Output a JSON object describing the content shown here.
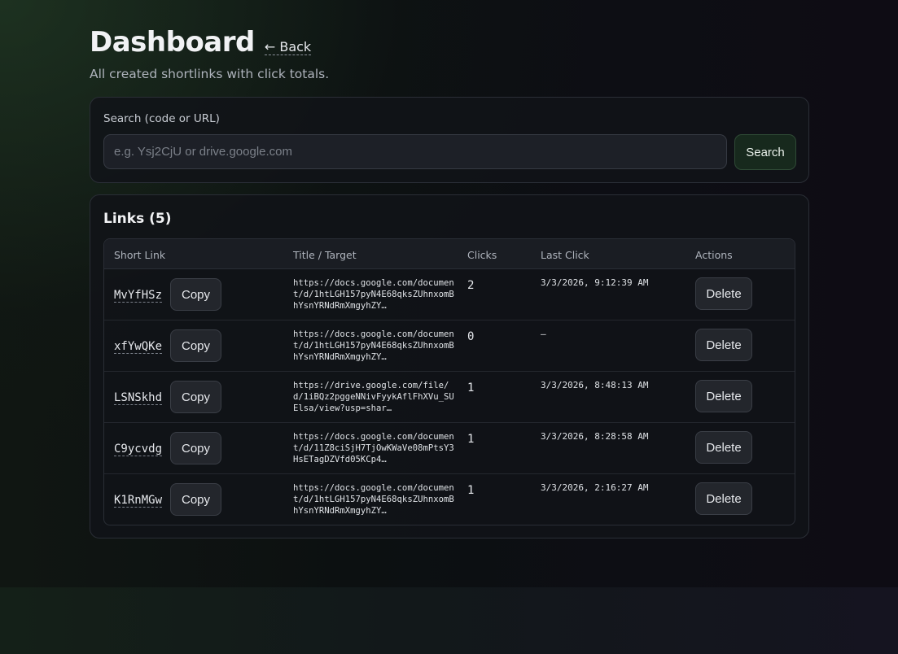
{
  "page": {
    "title": "Dashboard",
    "back_label": "← Back",
    "subtitle": "All created shortlinks with click totals."
  },
  "search": {
    "label": "Search (code or URL)",
    "placeholder": "e.g. Ysj2CjU or drive.google.com",
    "value": "",
    "button_label": "Search"
  },
  "links": {
    "title": "Links (5)",
    "columns": [
      "Short Link",
      "Title / Target",
      "Clicks",
      "Last Click",
      "Actions"
    ],
    "copy_label": "Copy",
    "delete_label": "Delete",
    "rows": [
      {
        "code": "MvYfHSz",
        "target": "https://docs.google.com/document/d/1htLGH157pyN4E68qksZUhnxomBhYsnYRNdRmXmgyhZY…",
        "clicks": "2",
        "last_click": "3/3/2026, 9:12:39 AM"
      },
      {
        "code": "xfYwQKe",
        "target": "https://docs.google.com/document/d/1htLGH157pyN4E68qksZUhnxomBhYsnYRNdRmXmgyhZY…",
        "clicks": "0",
        "last_click": "—"
      },
      {
        "code": "LSNSkhd",
        "target": "https://drive.google.com/file/d/1iBQz2pggeNNivFyykAflFhXVu_SUElsa/view?usp=shar…",
        "clicks": "1",
        "last_click": "3/3/2026, 8:48:13 AM"
      },
      {
        "code": "C9ycvdg",
        "target": "https://docs.google.com/document/d/11Z8ciSjH7TjOwKWaVe08mPtsY3HsETagDZVfd05KCp4…",
        "clicks": "1",
        "last_click": "3/3/2026, 8:28:58 AM"
      },
      {
        "code": "K1RnMGw",
        "target": "https://docs.google.com/document/d/1htLGH157pyN4E68qksZUhnxomBhYsnYRNdRmXmgyhZY…",
        "clicks": "1",
        "last_click": "3/3/2026, 2:16:27 AM"
      }
    ]
  },
  "colors": {
    "accent_button_bg": "#17291d",
    "accent_button_border": "#2f4a36",
    "card_bg": "#111318",
    "text": "#e6e8ec"
  }
}
